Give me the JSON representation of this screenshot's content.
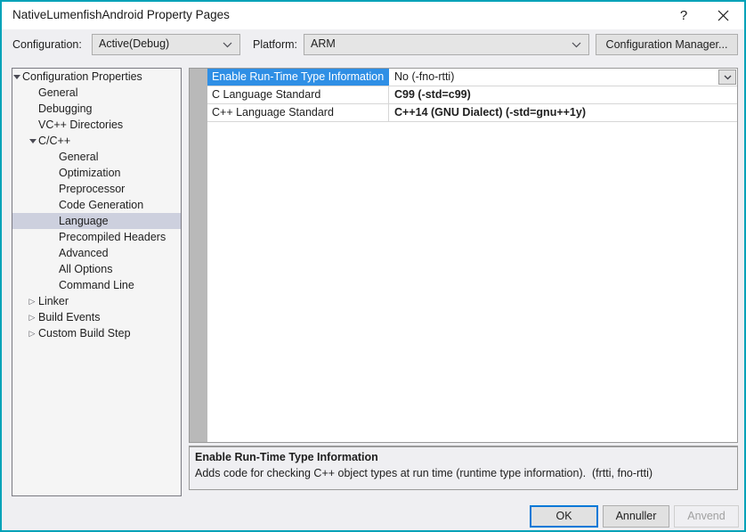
{
  "window": {
    "title": "NativeLumenfishAndroid Property Pages",
    "border_color": "#00A2B8",
    "help_icon": "question-mark-icon",
    "close_icon": "close-icon"
  },
  "config_bar": {
    "configuration_label": "Configuration:",
    "configuration_value": "Active(Debug)",
    "platform_label": "Platform:",
    "platform_value": "ARM",
    "configuration_manager_label": "Configuration Manager..."
  },
  "tree": {
    "selected": "Language",
    "items": [
      {
        "label": "Configuration Properties",
        "indent": 0,
        "expander": "open"
      },
      {
        "label": "General",
        "indent": 1,
        "expander": "none"
      },
      {
        "label": "Debugging",
        "indent": 1,
        "expander": "none"
      },
      {
        "label": "VC++ Directories",
        "indent": 1,
        "expander": "none"
      },
      {
        "label": "C/C++",
        "indent": 1,
        "expander": "open"
      },
      {
        "label": "General",
        "indent": 2,
        "expander": "none"
      },
      {
        "label": "Optimization",
        "indent": 2,
        "expander": "none"
      },
      {
        "label": "Preprocessor",
        "indent": 2,
        "expander": "none"
      },
      {
        "label": "Code Generation",
        "indent": 2,
        "expander": "none"
      },
      {
        "label": "Language",
        "indent": 2,
        "expander": "none",
        "selected": true
      },
      {
        "label": "Precompiled Headers",
        "indent": 2,
        "expander": "none"
      },
      {
        "label": "Advanced",
        "indent": 2,
        "expander": "none"
      },
      {
        "label": "All Options",
        "indent": 2,
        "expander": "none"
      },
      {
        "label": "Command Line",
        "indent": 2,
        "expander": "none"
      },
      {
        "label": "Linker",
        "indent": 1,
        "expander": "closed"
      },
      {
        "label": "Build Events",
        "indent": 1,
        "expander": "closed"
      },
      {
        "label": "Custom Build Step",
        "indent": 1,
        "expander": "closed"
      }
    ]
  },
  "grid": {
    "selection_color": "#2F8FE5",
    "rows": [
      {
        "name": "Enable Run-Time Type Information",
        "value": "No (-fno-rtti)",
        "selected": true,
        "bold_value": false,
        "has_dropdown": true
      },
      {
        "name": "C Language Standard",
        "value": "C99 (-std=c99)",
        "selected": false,
        "bold_value": true,
        "has_dropdown": false
      },
      {
        "name": "C++ Language Standard",
        "value": "C++14 (GNU Dialect) (-std=gnu++1y)",
        "selected": false,
        "bold_value": true,
        "has_dropdown": false
      }
    ]
  },
  "description": {
    "title": "Enable Run-Time Type Information",
    "text": "Adds code for checking C++ object types at run time (runtime type information).",
    "flags": "(frtti, fno-rtti)"
  },
  "footer": {
    "ok_label": "OK",
    "cancel_label": "Annuller",
    "apply_label": "Anvend",
    "apply_enabled": false
  }
}
